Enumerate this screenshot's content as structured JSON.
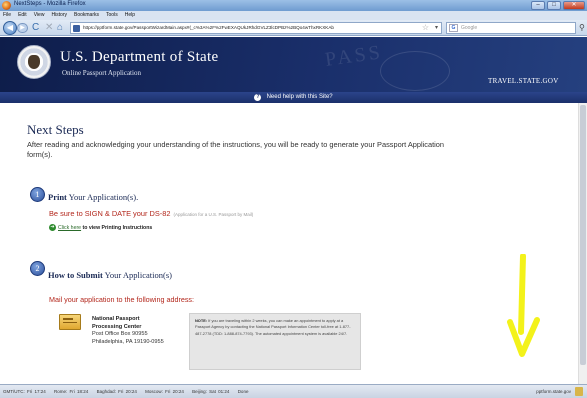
{
  "window": {
    "title": "NextSteps - Mozilla Firefox",
    "minimize_glyph": "–",
    "maximize_glyph": "□",
    "close_glyph": "✕"
  },
  "menu": [
    "File",
    "Edit",
    "View",
    "History",
    "Bookmarks",
    "Tools",
    "Help"
  ],
  "navbar": {
    "back_glyph": "◀",
    "forward_glyph": "▶",
    "reload_glyph": "C",
    "stop_glyph": "✕",
    "home_glyph": "⌂",
    "url": "https://pptform.state.gov/PassportWizardMain.aspx#(_c%3A%2F%2FwEXAQUkJRhdGVLZ3lcDPBz%2BQo4wThxRKXKAb",
    "search_placeholder": "Google",
    "search_engine_glyph": "G"
  },
  "banner": {
    "title": "U.S. Department of State",
    "subtitle": "Online Passport Application",
    "watermark": "PASS",
    "travel_link": "TRAVEL.STATE.GOV",
    "help_icon_glyph": "?",
    "help_text": "Need help with this Site?"
  },
  "content": {
    "page_title": "Next Steps",
    "intro": "After reading and acknowledging your understanding of the instructions, you will be ready to generate your Passport Application form(s).",
    "step1": {
      "number": "1",
      "heading_bold": "Print",
      "heading_rest": " Your Application(s).",
      "sign_text": "Be sure to SIGN & DATE your DS-82",
      "sign_note": "(Application for a U.S. Passport by Mail)",
      "print_link": "Click here",
      "print_rest": " to view Printing Instructions"
    },
    "step2": {
      "number": "2",
      "heading_bold": "How to Submit",
      "heading_rest": " Your Application(s)",
      "mail_text": "Mail your application to the following address:",
      "address_org_1": "National Passport",
      "address_org_2": "Processing Center",
      "address_line_1": "Post Office Box 90955",
      "address_line_2": "Philadelphia, PA 19190-0955",
      "notice_label": "NOTE:",
      "notice_text": "If you are traveling within 2 weeks, you can make an appointment to apply at a Passport Agency by contacting the National Passport Information Center toll-free at 1-877-487-2778 (TDD: 1-888-874-7793). The automated appointment system is available 24/7."
    }
  },
  "statusbar": {
    "clocks": [
      "GMT/UTC: Fri 17:24",
      "Rome: Fri 18:24",
      "Baghdad: Fri 20:24",
      "Moscow: Fri 20:24",
      "Beijing: Sat 01:24",
      "Done"
    ],
    "host": "pptform.state.gov"
  },
  "colors": {
    "banner_navy": "#1a2f6b",
    "alert_red": "#b3271c",
    "annotation_yellow": "#f3f21a"
  }
}
